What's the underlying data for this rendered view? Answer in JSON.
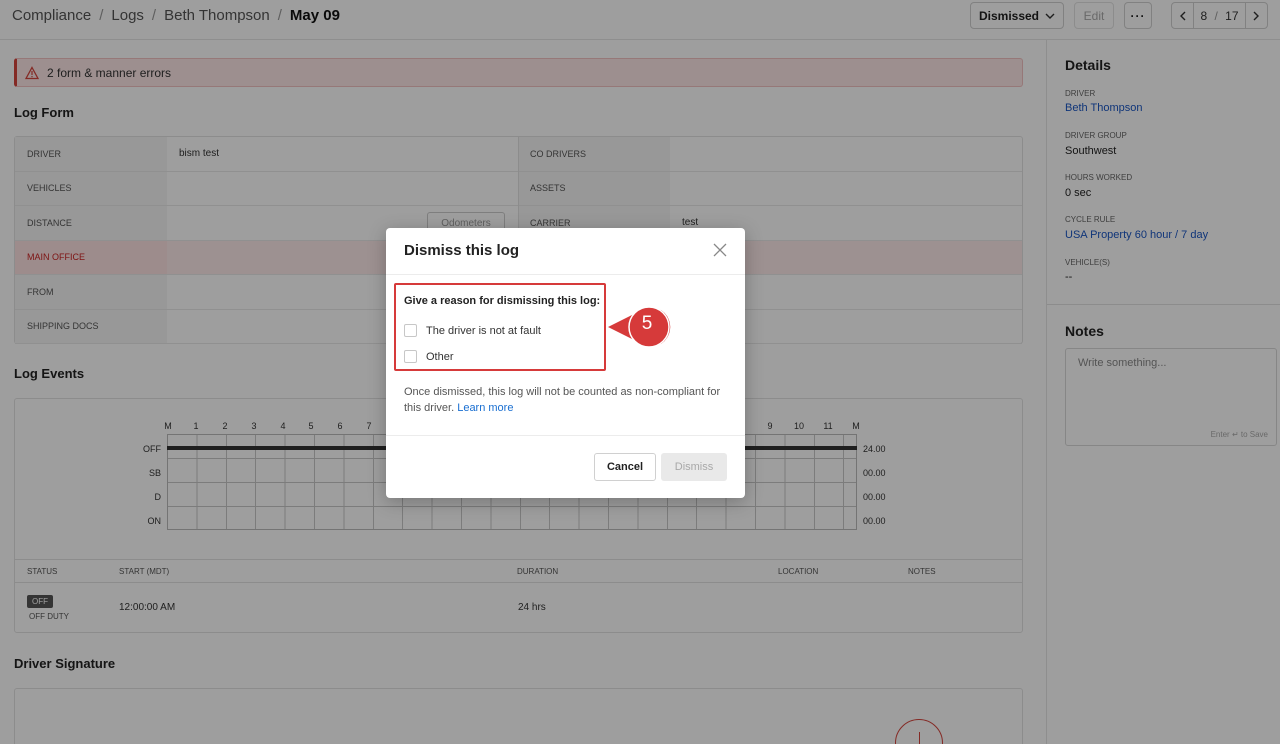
{
  "breadcrumb": {
    "items": [
      "Compliance",
      "Logs",
      "Beth Thompson"
    ],
    "current": "May 09",
    "separator": "/"
  },
  "toolbar": {
    "status_label": "Dismissed",
    "edit_label": "Edit",
    "more_label": "···",
    "pager_current": "8",
    "pager_separator": "/",
    "pager_total": "17"
  },
  "alert": {
    "text": "2 form & manner errors"
  },
  "log_form": {
    "title": "Log Form",
    "rows": [
      {
        "left_label": "DRIVER",
        "left_value": "bism test",
        "right_label": "CO DRIVERS",
        "right_value": ""
      },
      {
        "left_label": "VEHICLES",
        "left_value": "",
        "right_label": "ASSETS",
        "right_value": ""
      },
      {
        "left_label": "DISTANCE",
        "left_value": "",
        "right_label": "CARRIER",
        "right_value": "test"
      },
      {
        "left_label": "MAIN OFFICE",
        "left_value": "",
        "right_label": "",
        "right_value": ""
      },
      {
        "left_label": "FROM",
        "left_value": "",
        "right_label": "",
        "right_value": ""
      },
      {
        "left_label": "SHIPPING DOCS",
        "left_value": "",
        "right_label": "",
        "right_value": ""
      }
    ],
    "odometers_label": "Odometers"
  },
  "log_events": {
    "title": "Log Events",
    "hours_left": [
      "M",
      "1",
      "2",
      "3",
      "4",
      "5",
      "6",
      "7"
    ],
    "hours_right": [
      "9",
      "10",
      "11",
      "M"
    ],
    "statuses": [
      "OFF",
      "SB",
      "D",
      "ON"
    ],
    "totals": [
      "24.00",
      "00.00",
      "00.00",
      "00.00"
    ],
    "columns": [
      "STATUS",
      "START (MDT)",
      "DURATION",
      "LOCATION",
      "NOTES"
    ],
    "rows": [
      {
        "status": "OFF",
        "status_sub": "OFF DUTY",
        "start": "12:00:00 AM",
        "duration": "24 hrs",
        "location": "",
        "notes": ""
      }
    ]
  },
  "signature": {
    "title": "Driver Signature"
  },
  "details": {
    "title": "Details",
    "fields": [
      {
        "key": "DRIVER",
        "value": "Beth Thompson"
      },
      {
        "key": "DRIVER GROUP",
        "value": "Southwest"
      },
      {
        "key": "HOURS WORKED",
        "value": "0 sec"
      },
      {
        "key": "CYCLE RULE",
        "value": "USA Property 60 hour / 7 day"
      },
      {
        "key": "VEHICLE(S)",
        "value": "--"
      }
    ]
  },
  "notes": {
    "title": "Notes",
    "placeholder": "Write something...",
    "hint": "Enter ↵ to Save"
  },
  "modal": {
    "title": "Dismiss this log",
    "reason_title": "Give a reason for dismissing this log:",
    "options": [
      "The driver is not at fault",
      "Other"
    ],
    "note": "Once dismissed, this log will not be counted as non-compliant for this driver.",
    "learn_more": "Learn more",
    "cancel_label": "Cancel",
    "dismiss_label": "Dismiss"
  },
  "annotation": {
    "step_number": "5",
    "color": "#d63a3a"
  }
}
